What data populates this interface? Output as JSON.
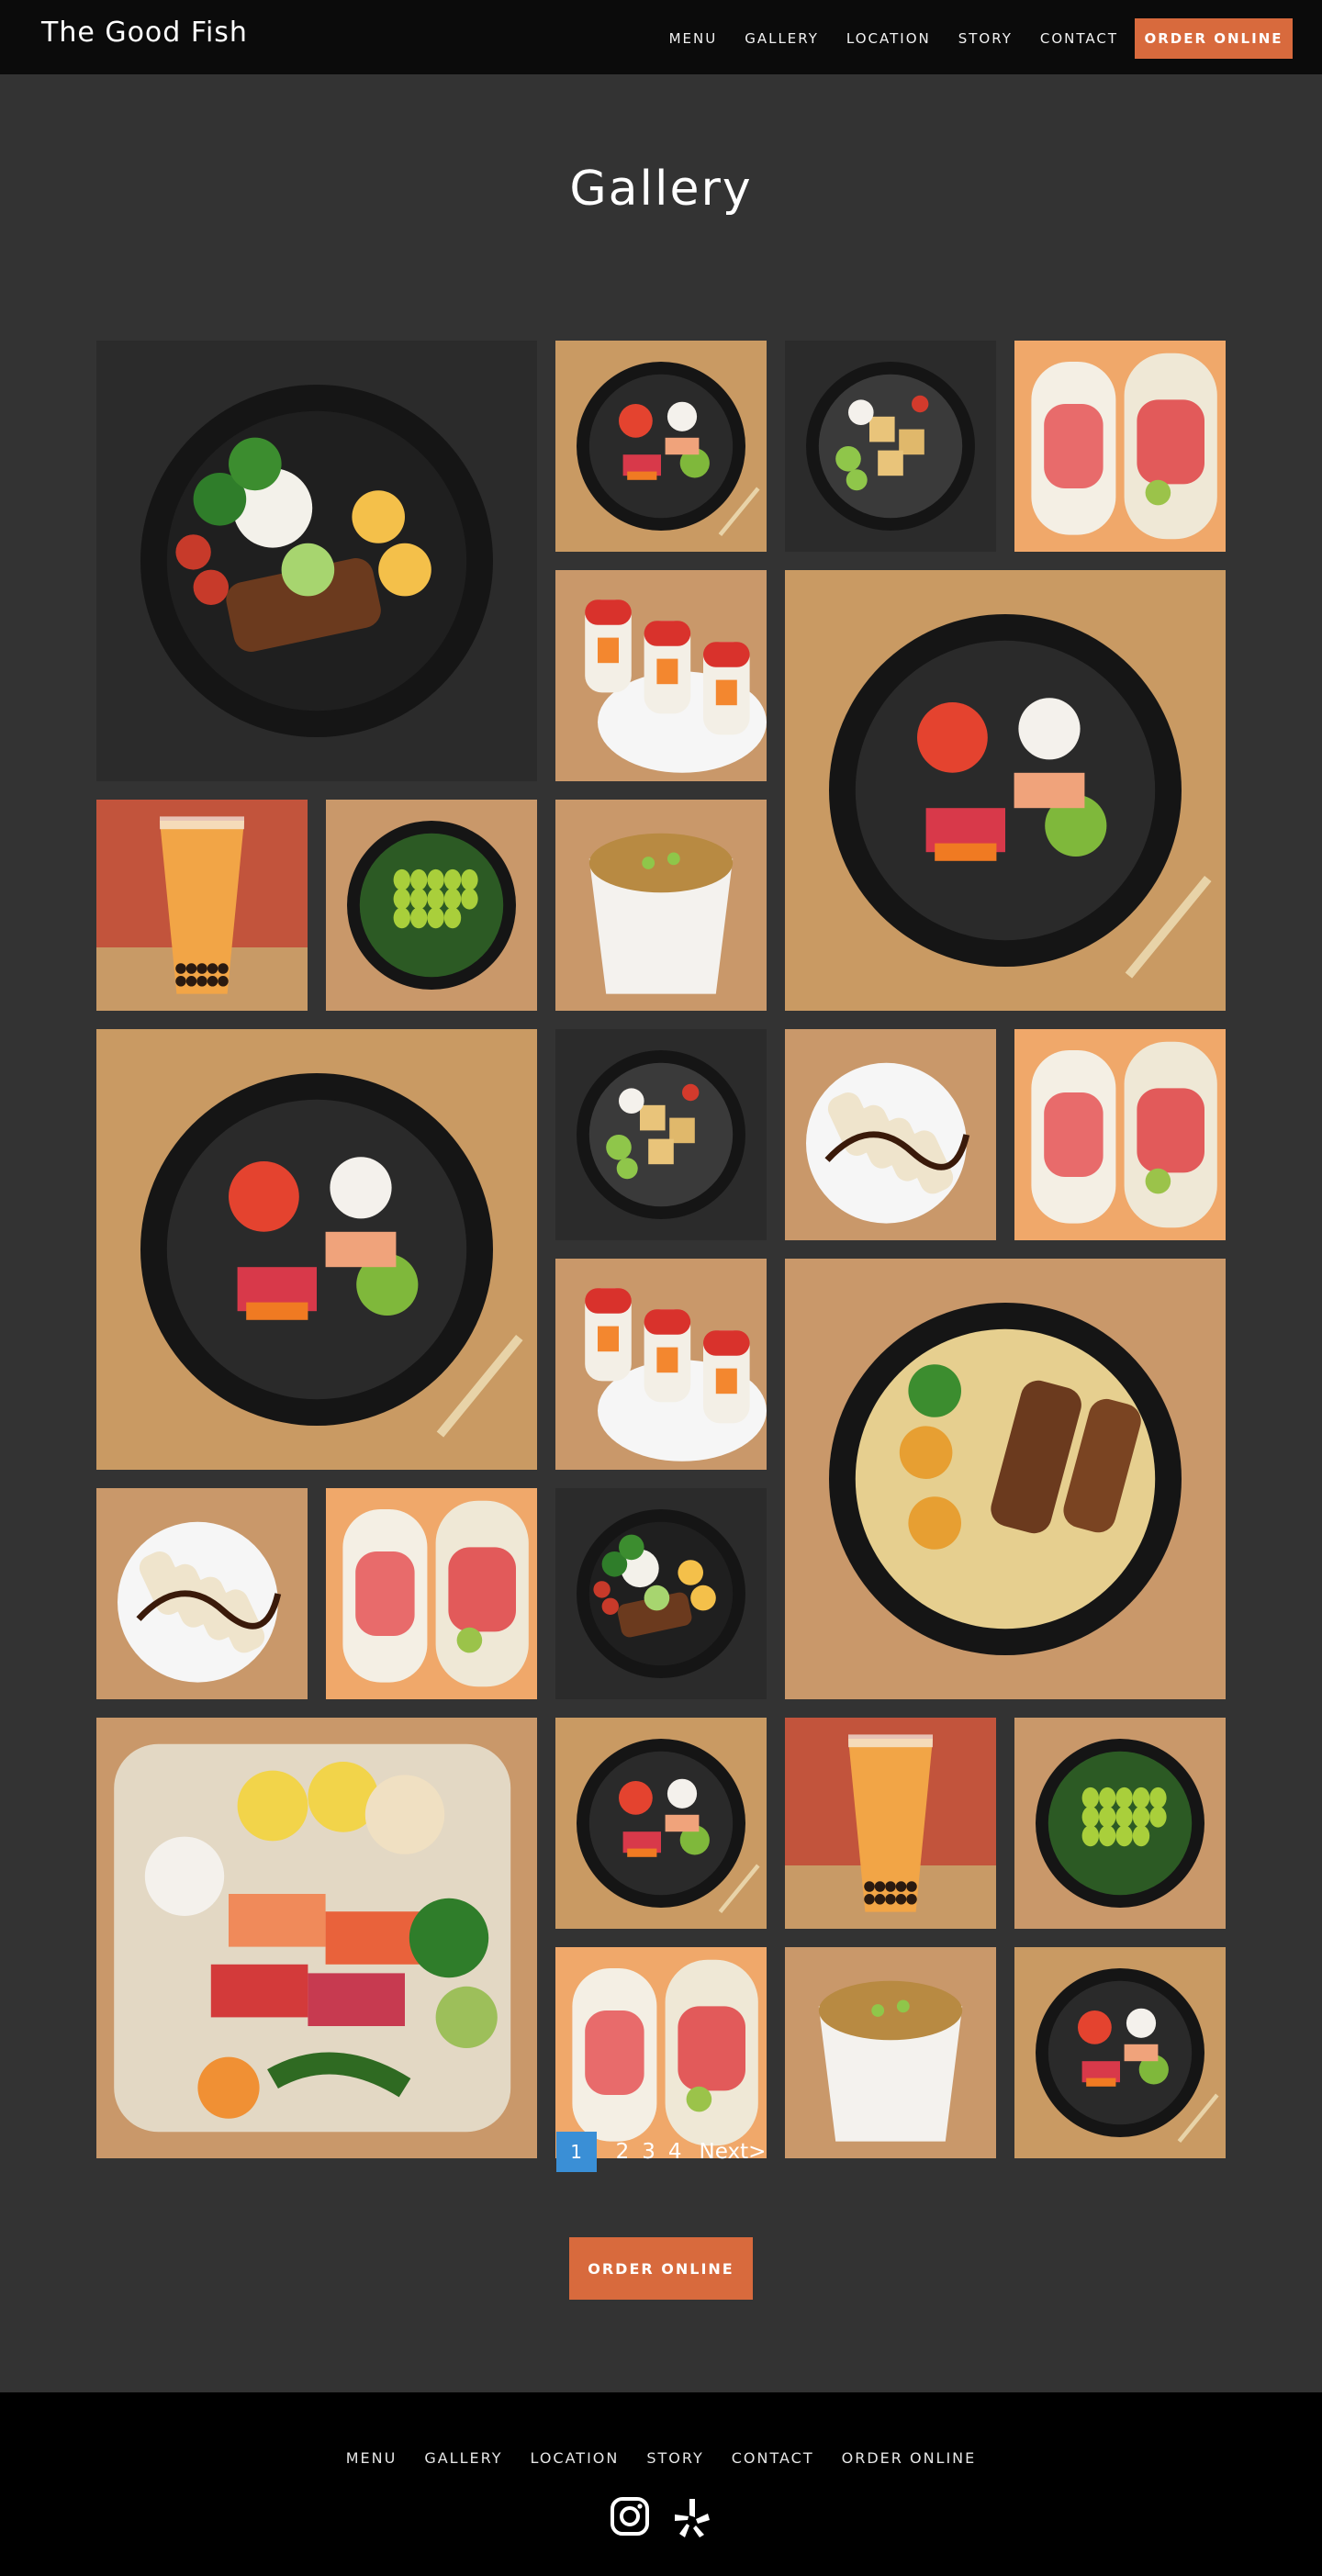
{
  "header": {
    "brand": "The Good Fish",
    "nav": [
      "MENU",
      "GALLERY",
      "LOCATION",
      "STORY",
      "CONTACT"
    ],
    "order_label": "ORDER ONLINE"
  },
  "gallery": {
    "title": "Gallery",
    "tiles": [
      "pork-belly-rice-bowl-photo",
      "poke-bowl-photo",
      "tofu-salad-bowl-photo",
      "sushi-burrito-photo",
      "sushi-roll-photo",
      "poke-bowl-photo",
      "boba-tea-photo",
      "edamame-salad-photo",
      "miso-soup-photo",
      "poke-bowl-photo",
      "tofu-salad-bowl-photo",
      "eel-sushi-plate-photo",
      "sushi-burrito-photo",
      "sushi-roll-photo",
      "ramen-bowl-photo",
      "eel-sushi-plate-photo",
      "sushi-burrito-photo",
      "pork-belly-rice-bowl-photo",
      "sashimi-platter-photo",
      "poke-bowl-photo",
      "boba-tea-photo",
      "edamame-salad-photo",
      "sushi-burrito-photo",
      "miso-soup-photo",
      "poke-bowl-photo"
    ]
  },
  "pagination": {
    "current": "1",
    "pages": [
      "2",
      "3",
      "4"
    ],
    "next_label": "Next>"
  },
  "cta": {
    "order_label": "ORDER ONLINE"
  },
  "footer": {
    "nav": [
      "MENU",
      "GALLERY",
      "LOCATION",
      "STORY",
      "CONTACT",
      "ORDER ONLINE"
    ],
    "icons": [
      "instagram-icon",
      "yelp-icon"
    ]
  },
  "colors": {
    "background": "#333333",
    "header": "#0b0b0b",
    "accent": "#d86a3d",
    "pagination_active": "#3a8fd6",
    "footer": "#000000"
  }
}
